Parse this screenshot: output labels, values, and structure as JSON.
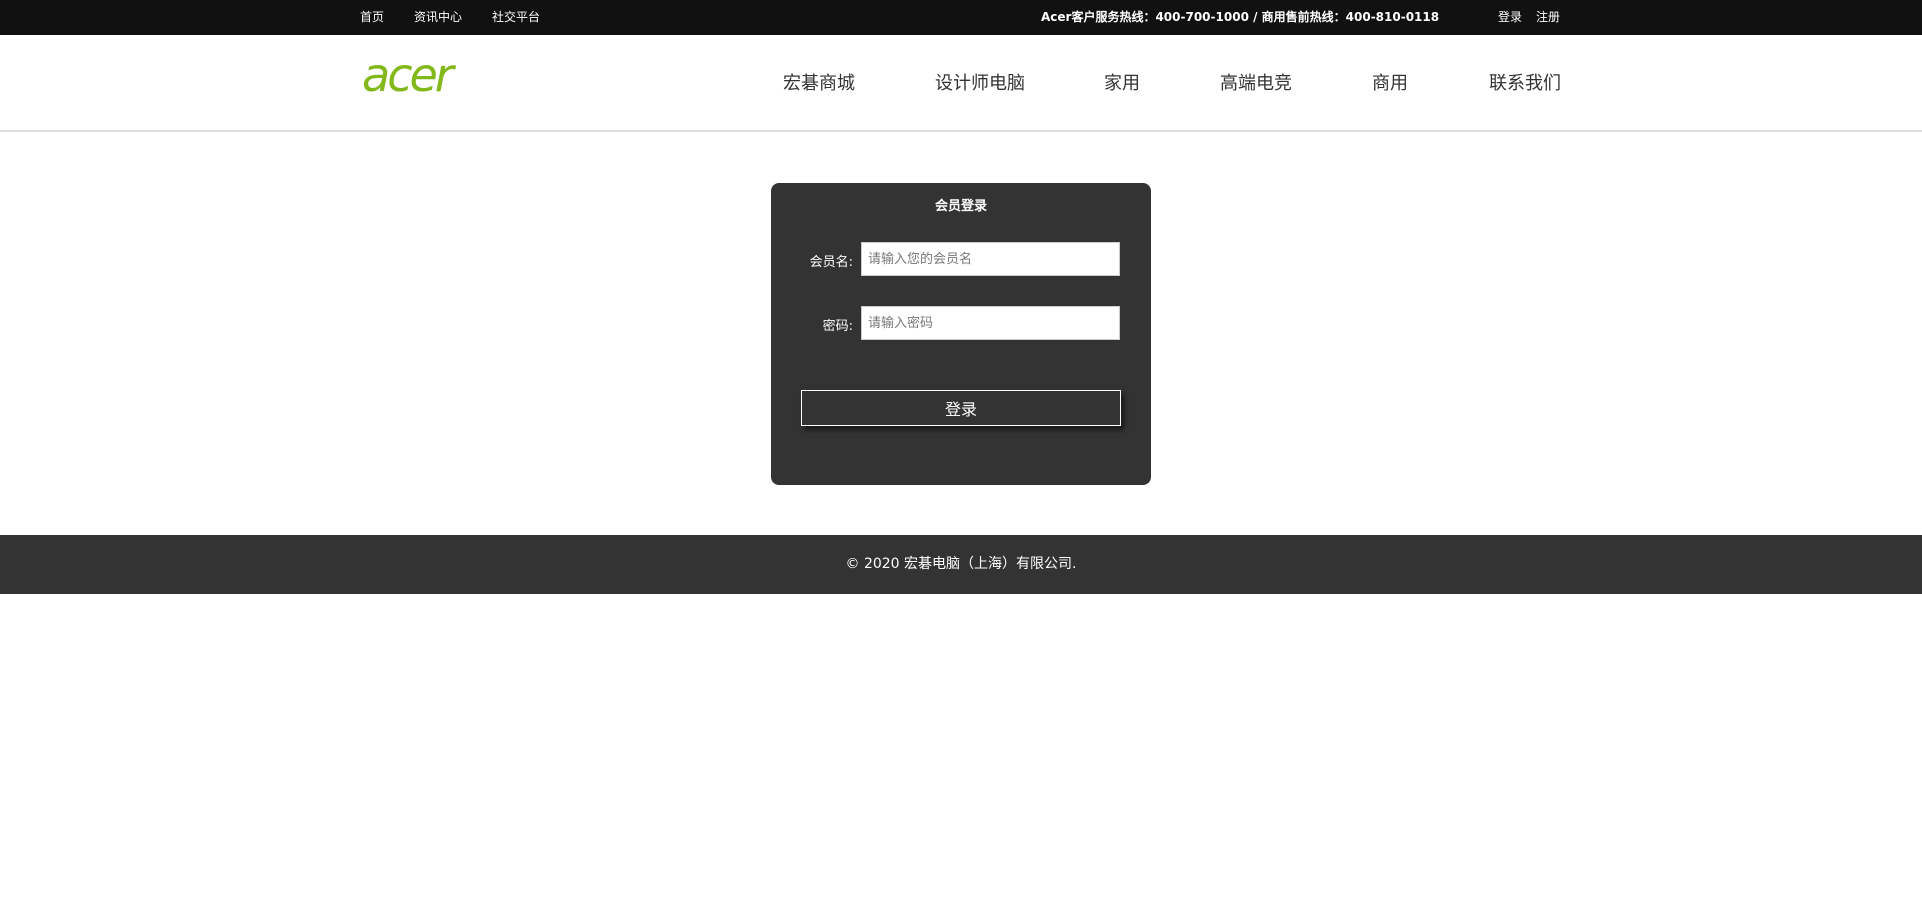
{
  "topbar": {
    "links": [
      "首页",
      "资讯中心",
      "社交平台"
    ],
    "hotline": "Acer客户服务热线：400-700-1000 / 商用售前热线：400-810-0118",
    "login": "登录",
    "register": "注册"
  },
  "header": {
    "logo_text": "acer",
    "nav": [
      "宏碁商城",
      "设计师电脑",
      "家用",
      "高端电竞",
      "商用",
      "联系我们"
    ]
  },
  "login_form": {
    "title": "会员登录",
    "username_label": "会员名:",
    "username_placeholder": "请输入您的会员名",
    "username_value": "",
    "password_label": "密码:",
    "password_placeholder": "请输入密码",
    "password_value": "",
    "submit_label": "登录"
  },
  "footer": {
    "copyright": "© 2020 宏碁电脑（上海）有限公司."
  },
  "colors": {
    "topbar_bg": "#111111",
    "brand_green": "#83b81a",
    "panel_bg": "#333333",
    "footer_bg": "#333333"
  }
}
